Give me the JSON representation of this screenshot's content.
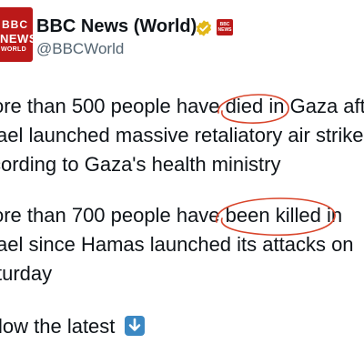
{
  "account": {
    "display_name": "BBC News (World)",
    "handle": "@BBCWorld",
    "avatar_text": {
      "line1": "BBC",
      "line2": "NEWS",
      "line3": "WORLD"
    },
    "mini_logo_text": "BBC NEWS",
    "verified_icon": "verified-badge-icon",
    "brand_color": "#bb1919"
  },
  "tweet": {
    "lines": [
      "ore than 500 people have died in Gaza aft",
      "ael launched massive retaliatory air strike",
      "cording to Gaza's health ministry",
      "ore than 700 people have been killed in",
      "ael since Hamas launched its attacks on",
      "turday",
      "low the latest"
    ],
    "emoji": "down-arrow-button-icon",
    "annotation_color": "#d9452b"
  }
}
